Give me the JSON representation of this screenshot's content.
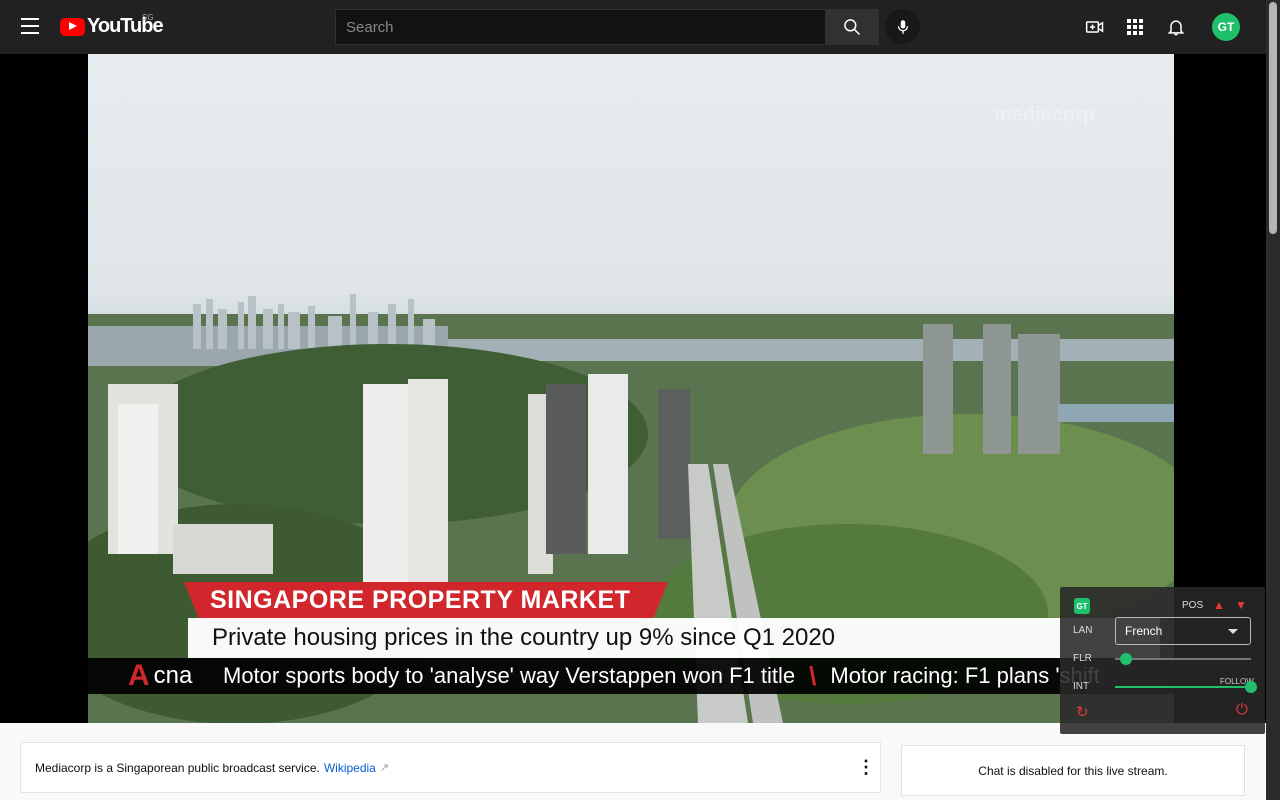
{
  "header": {
    "logo_text": "YouTube",
    "region": "SG",
    "search_placeholder": "Search",
    "avatar_initials": "GT"
  },
  "video": {
    "watermark": "mediacorp",
    "headline_banner": "SINGAPORE PROPERTY MARKET",
    "subheadline": "Private housing prices in the country up 9% since Q1 2020",
    "channel_logo_mark": "A",
    "channel_logo_text": "cna",
    "ticker_items": [
      "Motor sports body to 'analyse' way Verstappen won F1 title",
      "Motor racing: F1 plans 'shift"
    ]
  },
  "extension": {
    "logo": "GT",
    "pos_label": "POS",
    "lan_label": "LAN",
    "language_value": "French",
    "flr_label": "FLR",
    "int_label": "INT",
    "follow_label": "FOLLOW",
    "flr_level": 0.08,
    "int_level": 1.0
  },
  "info_panel": {
    "description": "Mediacorp is a Singaporean public broadcast service.",
    "link_text": "Wikipedia"
  },
  "chat": {
    "message": "Chat is disabled for this live stream."
  },
  "colors": {
    "header_bg": "#212121",
    "brand_red": "#ff0000",
    "cna_red": "#d0262c",
    "extension_green": "#1fbf6b",
    "link_blue": "#065fd4"
  }
}
